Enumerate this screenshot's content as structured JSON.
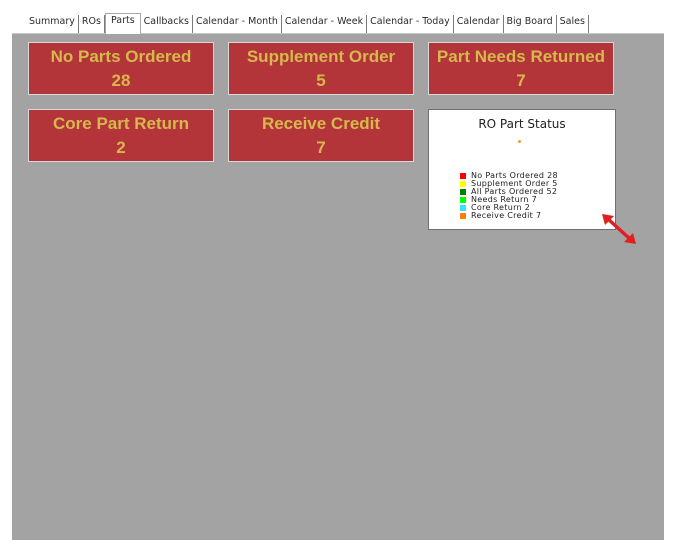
{
  "tabs": [
    {
      "label": "Summary",
      "active": false
    },
    {
      "label": "ROs",
      "active": false
    },
    {
      "label": "Parts",
      "active": true
    },
    {
      "label": "Callbacks",
      "active": false
    },
    {
      "label": "Calendar - Month",
      "active": false
    },
    {
      "label": "Calendar - Week",
      "active": false
    },
    {
      "label": "Calendar - Today",
      "active": false
    },
    {
      "label": "Calendar",
      "active": false
    },
    {
      "label": "Big Board",
      "active": false
    },
    {
      "label": "Sales",
      "active": false
    }
  ],
  "tiles": {
    "no_parts_ordered": {
      "title": "No Parts Ordered",
      "count": "28"
    },
    "supplement_order": {
      "title": "Supplement Order",
      "count": "5"
    },
    "part_needs_returned": {
      "title": "Part Needs Returned",
      "count": "7"
    },
    "core_part_return": {
      "title": "Core Part Return",
      "count": "2"
    },
    "receive_credit": {
      "title": "Receive Credit",
      "count": "7"
    }
  },
  "colors": {
    "tile_background": "#b3353a",
    "tile_text": "#d6b84c",
    "panel_background": "#a3a3a3",
    "resize_arrow": "#e02020"
  },
  "chart_data": {
    "type": "pie",
    "title": "RO Part Status",
    "legend_position": "bottom",
    "series": [
      {
        "label": "No Parts Ordered 28",
        "name": "No Parts Ordered",
        "value": 28,
        "color": "#ff0000"
      },
      {
        "label": "Supplement Order 5",
        "name": "Supplement Order",
        "value": 5,
        "color": "#ffff00"
      },
      {
        "label": "All Parts Ordered 52",
        "name": "All Parts Ordered",
        "value": 52,
        "color": "#008000"
      },
      {
        "label": "Needs Return 7",
        "name": "Needs Return",
        "value": 7,
        "color": "#00ff00"
      },
      {
        "label": "Core Return 2",
        "name": "Core Return",
        "value": 2,
        "color": "#33e5ff"
      },
      {
        "label": "Receive Credit 7",
        "name": "Receive Credit",
        "value": 7,
        "color": "#ff8000"
      }
    ]
  },
  "icons": {
    "resize_arrow": "double-headed-diagonal-arrow-icon"
  }
}
